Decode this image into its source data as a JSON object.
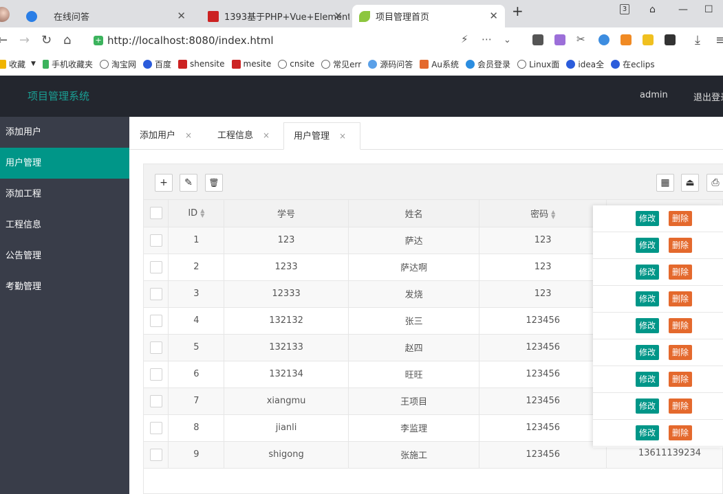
{
  "browser": {
    "tabs": [
      {
        "label": "在线问答",
        "color": "#5aa0e8"
      },
      {
        "label": "1393基于PHP+Vue+Element",
        "color": "#cc2222"
      },
      {
        "label": "项目管理首页",
        "color": "#8dc63f"
      }
    ],
    "tab_count": "3",
    "url": "http://localhost:8080/index.html",
    "bookmarks": [
      "收藏",
      "手机收藏夹",
      "淘宝网",
      "百度",
      "shensite",
      "mesite",
      "cnsite",
      "常见err",
      "源码问答",
      "Au系统",
      "会员登录",
      "Linux面",
      "idea全",
      "在eclips"
    ]
  },
  "app": {
    "title": "项目管理系统",
    "user": "admin",
    "logout": "退出登录",
    "sidebar": [
      {
        "label": "添加用户",
        "active": false
      },
      {
        "label": "用户管理",
        "active": true
      },
      {
        "label": "添加工程",
        "active": false
      },
      {
        "label": "工程信息",
        "active": false
      },
      {
        "label": "公告管理",
        "active": false
      },
      {
        "label": "考勤管理",
        "active": false
      }
    ],
    "content_tabs": [
      {
        "label": "添加用户",
        "close": "×"
      },
      {
        "label": "工程信息",
        "close": "×"
      },
      {
        "label": "用户管理",
        "close": "×"
      }
    ],
    "table": {
      "headers": [
        "ID",
        "学号",
        "姓名",
        "密码"
      ],
      "rows": [
        [
          "1",
          "123",
          "萨达",
          "123"
        ],
        [
          "2",
          "1233",
          "萨达啊",
          "123"
        ],
        [
          "3",
          "12333",
          "发烧",
          "123"
        ],
        [
          "4",
          "132132",
          "张三",
          "123456"
        ],
        [
          "5",
          "132133",
          "赵四",
          "123456"
        ],
        [
          "6",
          "132134",
          "旺旺",
          "123456"
        ],
        [
          "7",
          "xiangmu",
          "王项目",
          "123456"
        ],
        [
          "8",
          "jianli",
          "李监理",
          "123456"
        ],
        [
          "9",
          "shigong",
          "张施工",
          "123456"
        ]
      ],
      "edit_label": "修改",
      "delete_label": "删除",
      "last_phone": "13611139234"
    },
    "colors": {
      "header": "#23262e",
      "sidebar": "#393d49",
      "accent": "#009688",
      "danger": "#e4692d"
    }
  }
}
